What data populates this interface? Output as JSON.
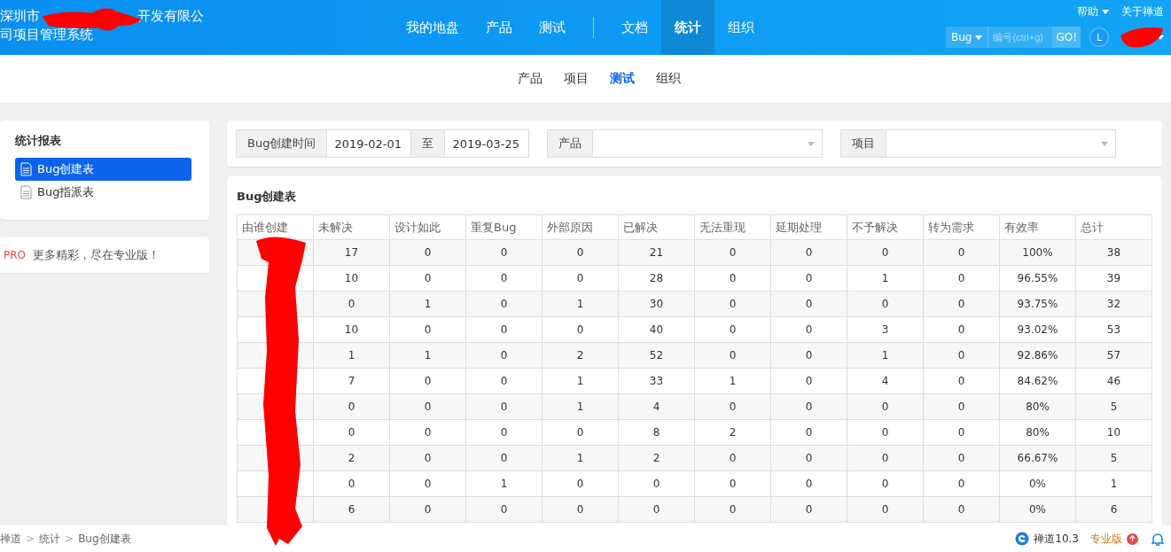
{
  "brand": {
    "lead": "深圳市",
    "tail": "开发有限公",
    "line2": "司项目管理系统"
  },
  "nav": [
    {
      "label": "我的地盘",
      "selected": false
    },
    {
      "label": "产品",
      "selected": false
    },
    {
      "label": "测试",
      "selected": false
    },
    {
      "kind": "divider"
    },
    {
      "label": "文档",
      "selected": false
    },
    {
      "label": "统计",
      "selected": true
    },
    {
      "label": "组织",
      "selected": false
    }
  ],
  "top_links": [
    "帮助",
    "关于禅道"
  ],
  "search": {
    "type": "Bug",
    "placeholder": "编号(ctrl+g)",
    "button": "GO!"
  },
  "user": {
    "initial": "L"
  },
  "subnav": [
    {
      "label": "产品",
      "selected": false
    },
    {
      "label": "项目",
      "selected": false
    },
    {
      "label": "测试",
      "selected": true
    },
    {
      "label": "组织",
      "selected": false
    }
  ],
  "sidebar": {
    "title": "统计报表",
    "items": [
      {
        "label": "Bug创建表",
        "selected": true
      },
      {
        "label": "Bug指派表",
        "selected": false
      }
    ]
  },
  "promo": {
    "badge": "PRO",
    "text": "更多精彩，尽在专业版！"
  },
  "filters": {
    "date_label": "Bug创建时间",
    "date_from": "2019-02-01",
    "to_label": "至",
    "date_to": "2019-03-25",
    "product_label": "产品",
    "project_label": "项目"
  },
  "table": {
    "title": "Bug创建表",
    "columns": [
      "由谁创建",
      "未解决",
      "设计如此",
      "重复Bug",
      "外部原因",
      "已解决",
      "无法重现",
      "延期处理",
      "不予解决",
      "转为需求",
      "有效率",
      "总计"
    ],
    "rows": [
      [
        "",
        "17",
        "0",
        "0",
        "0",
        "21",
        "0",
        "0",
        "0",
        "0",
        "100%",
        "38"
      ],
      [
        "",
        "10",
        "0",
        "0",
        "0",
        "28",
        "0",
        "0",
        "1",
        "0",
        "96.55%",
        "39"
      ],
      [
        "",
        "0",
        "1",
        "0",
        "1",
        "30",
        "0",
        "0",
        "0",
        "0",
        "93.75%",
        "32"
      ],
      [
        "",
        "10",
        "0",
        "0",
        "0",
        "40",
        "0",
        "0",
        "3",
        "0",
        "93.02%",
        "53"
      ],
      [
        "",
        "1",
        "1",
        "0",
        "2",
        "52",
        "0",
        "0",
        "1",
        "0",
        "92.86%",
        "57"
      ],
      [
        "",
        "7",
        "0",
        "0",
        "1",
        "33",
        "1",
        "0",
        "4",
        "0",
        "84.62%",
        "46"
      ],
      [
        "",
        "0",
        "0",
        "0",
        "1",
        "4",
        "0",
        "0",
        "0",
        "0",
        "80%",
        "5"
      ],
      [
        "",
        "0",
        "0",
        "0",
        "0",
        "8",
        "2",
        "0",
        "0",
        "0",
        "80%",
        "10"
      ],
      [
        "",
        "2",
        "0",
        "0",
        "1",
        "2",
        "0",
        "0",
        "0",
        "0",
        "66.67%",
        "5"
      ],
      [
        "",
        "0",
        "0",
        "1",
        "0",
        "0",
        "0",
        "0",
        "0",
        "0",
        "0%",
        "1"
      ],
      [
        "",
        "6",
        "0",
        "0",
        "0",
        "0",
        "0",
        "0",
        "0",
        "0",
        "0%",
        "6"
      ]
    ]
  },
  "breadcrumb": {
    "items": [
      "禅道",
      "统计",
      "Bug创建表"
    ],
    "separator": ">"
  },
  "footer": {
    "version": "禅道10.3",
    "edition": "专业版"
  }
}
